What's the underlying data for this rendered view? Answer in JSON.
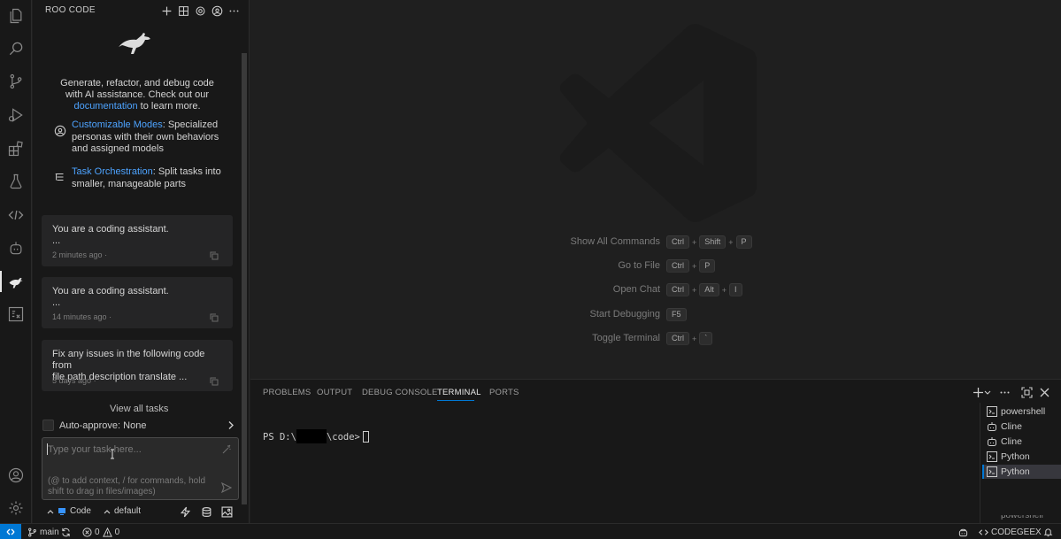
{
  "sidebar": {
    "title": "ROO CODE",
    "intro": {
      "text_before": "Generate, refactor, and debug code with AI assistance. Check out our ",
      "link": "documentation",
      "text_after": " to learn more."
    },
    "features": [
      {
        "link": "Customizable Modes",
        "text": ": Specialized personas with their own behaviors and assigned models",
        "icon": "account-icon"
      },
      {
        "link": "Task Orchestration",
        "text": ": Split tasks into smaller, manageable parts",
        "icon": "list-tree-icon"
      }
    ],
    "tasks": [
      {
        "line1": "You are a coding assistant.",
        "line2": "...",
        "time": "2 minutes ago",
        "sep": "·"
      },
      {
        "line1": "You are a coding assistant.",
        "line2": "...",
        "time": "14 minutes ago",
        "sep": "·"
      },
      {
        "line1": "Fix any issues in the following code from",
        "line2": "file path description translate ...",
        "time": "5 days ago",
        "sep": "·"
      }
    ],
    "view_all": "View all tasks",
    "auto_approve": {
      "label": "Auto-approve:",
      "value": "None"
    },
    "chat_input": {
      "placeholder": "Type your task here...",
      "hint": "(@ to add context, / for commands, hold shift to drag in files/images)"
    },
    "footer": {
      "mode": "Code",
      "config": "default"
    }
  },
  "editor": {
    "shortcuts": [
      {
        "label": "Show All Commands",
        "keys": [
          "Ctrl",
          "Shift",
          "P"
        ]
      },
      {
        "label": "Go to File",
        "keys": [
          "Ctrl",
          "P"
        ]
      },
      {
        "label": "Open Chat",
        "keys": [
          "Ctrl",
          "Alt",
          "I"
        ]
      },
      {
        "label": "Start Debugging",
        "keys": [
          "F5"
        ]
      },
      {
        "label": "Toggle Terminal",
        "keys": [
          "Ctrl",
          "`"
        ]
      }
    ]
  },
  "panel": {
    "tabs": [
      "PROBLEMS",
      "OUTPUT",
      "DEBUG CONSOLE",
      "TERMINAL",
      "PORTS"
    ],
    "active_tab": "TERMINAL",
    "prompt_prefix": "PS D:\\",
    "prompt_suffix": "\\code>",
    "terminals": [
      {
        "label": "powershell",
        "icon": "terminal-icon"
      },
      {
        "label": "Cline",
        "icon": "robot-icon"
      },
      {
        "label": "Cline",
        "icon": "robot-icon"
      },
      {
        "label": "Python",
        "icon": "terminal-icon"
      },
      {
        "label": "Python",
        "icon": "terminal-icon",
        "selected": true
      }
    ],
    "terminal_more": "powershell"
  },
  "statusbar": {
    "branch": "main",
    "errors": "0",
    "warnings": "0",
    "extension": "CODEGEEX"
  },
  "colors": {
    "accent": "#0078d4",
    "link": "#4da3ff"
  }
}
